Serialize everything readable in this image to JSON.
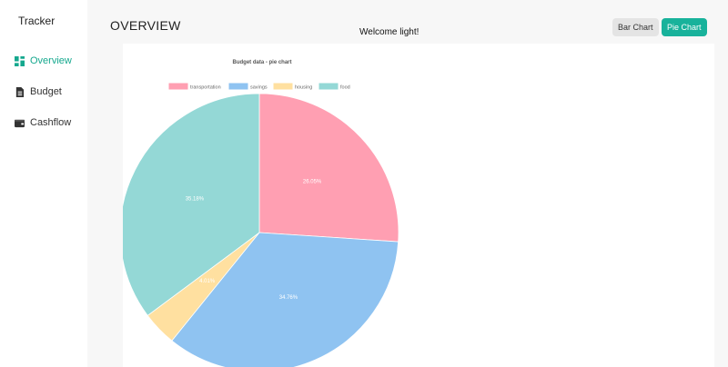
{
  "sidebar": {
    "brand": "Tracker",
    "items": [
      {
        "label": "Overview",
        "icon": "dashboard-icon",
        "active": true
      },
      {
        "label": "Budget",
        "icon": "document-icon",
        "active": false
      },
      {
        "label": "Cashflow",
        "icon": "wallet-icon",
        "active": false
      }
    ]
  },
  "header": {
    "title": "OVERVIEW",
    "welcome": "Welcome light!",
    "bar_chart_label": "Bar Chart",
    "pie_chart_label": "Pie Chart"
  },
  "colors": {
    "accent": "#18b29b",
    "transportation": "#ff9fb2",
    "savings": "#8fc3f1",
    "housing": "#ffe0a0",
    "food": "#94d8d6"
  },
  "chart_data": {
    "type": "pie",
    "title": "Budget data - pie chart",
    "categories": [
      "transportation",
      "savings",
      "housing",
      "food"
    ],
    "values": [
      26.05,
      34.76,
      4.01,
      35.18
    ],
    "labels": [
      "26.05%",
      "34.76%",
      "4.01%",
      "35.18%"
    ],
    "legend": "top"
  }
}
